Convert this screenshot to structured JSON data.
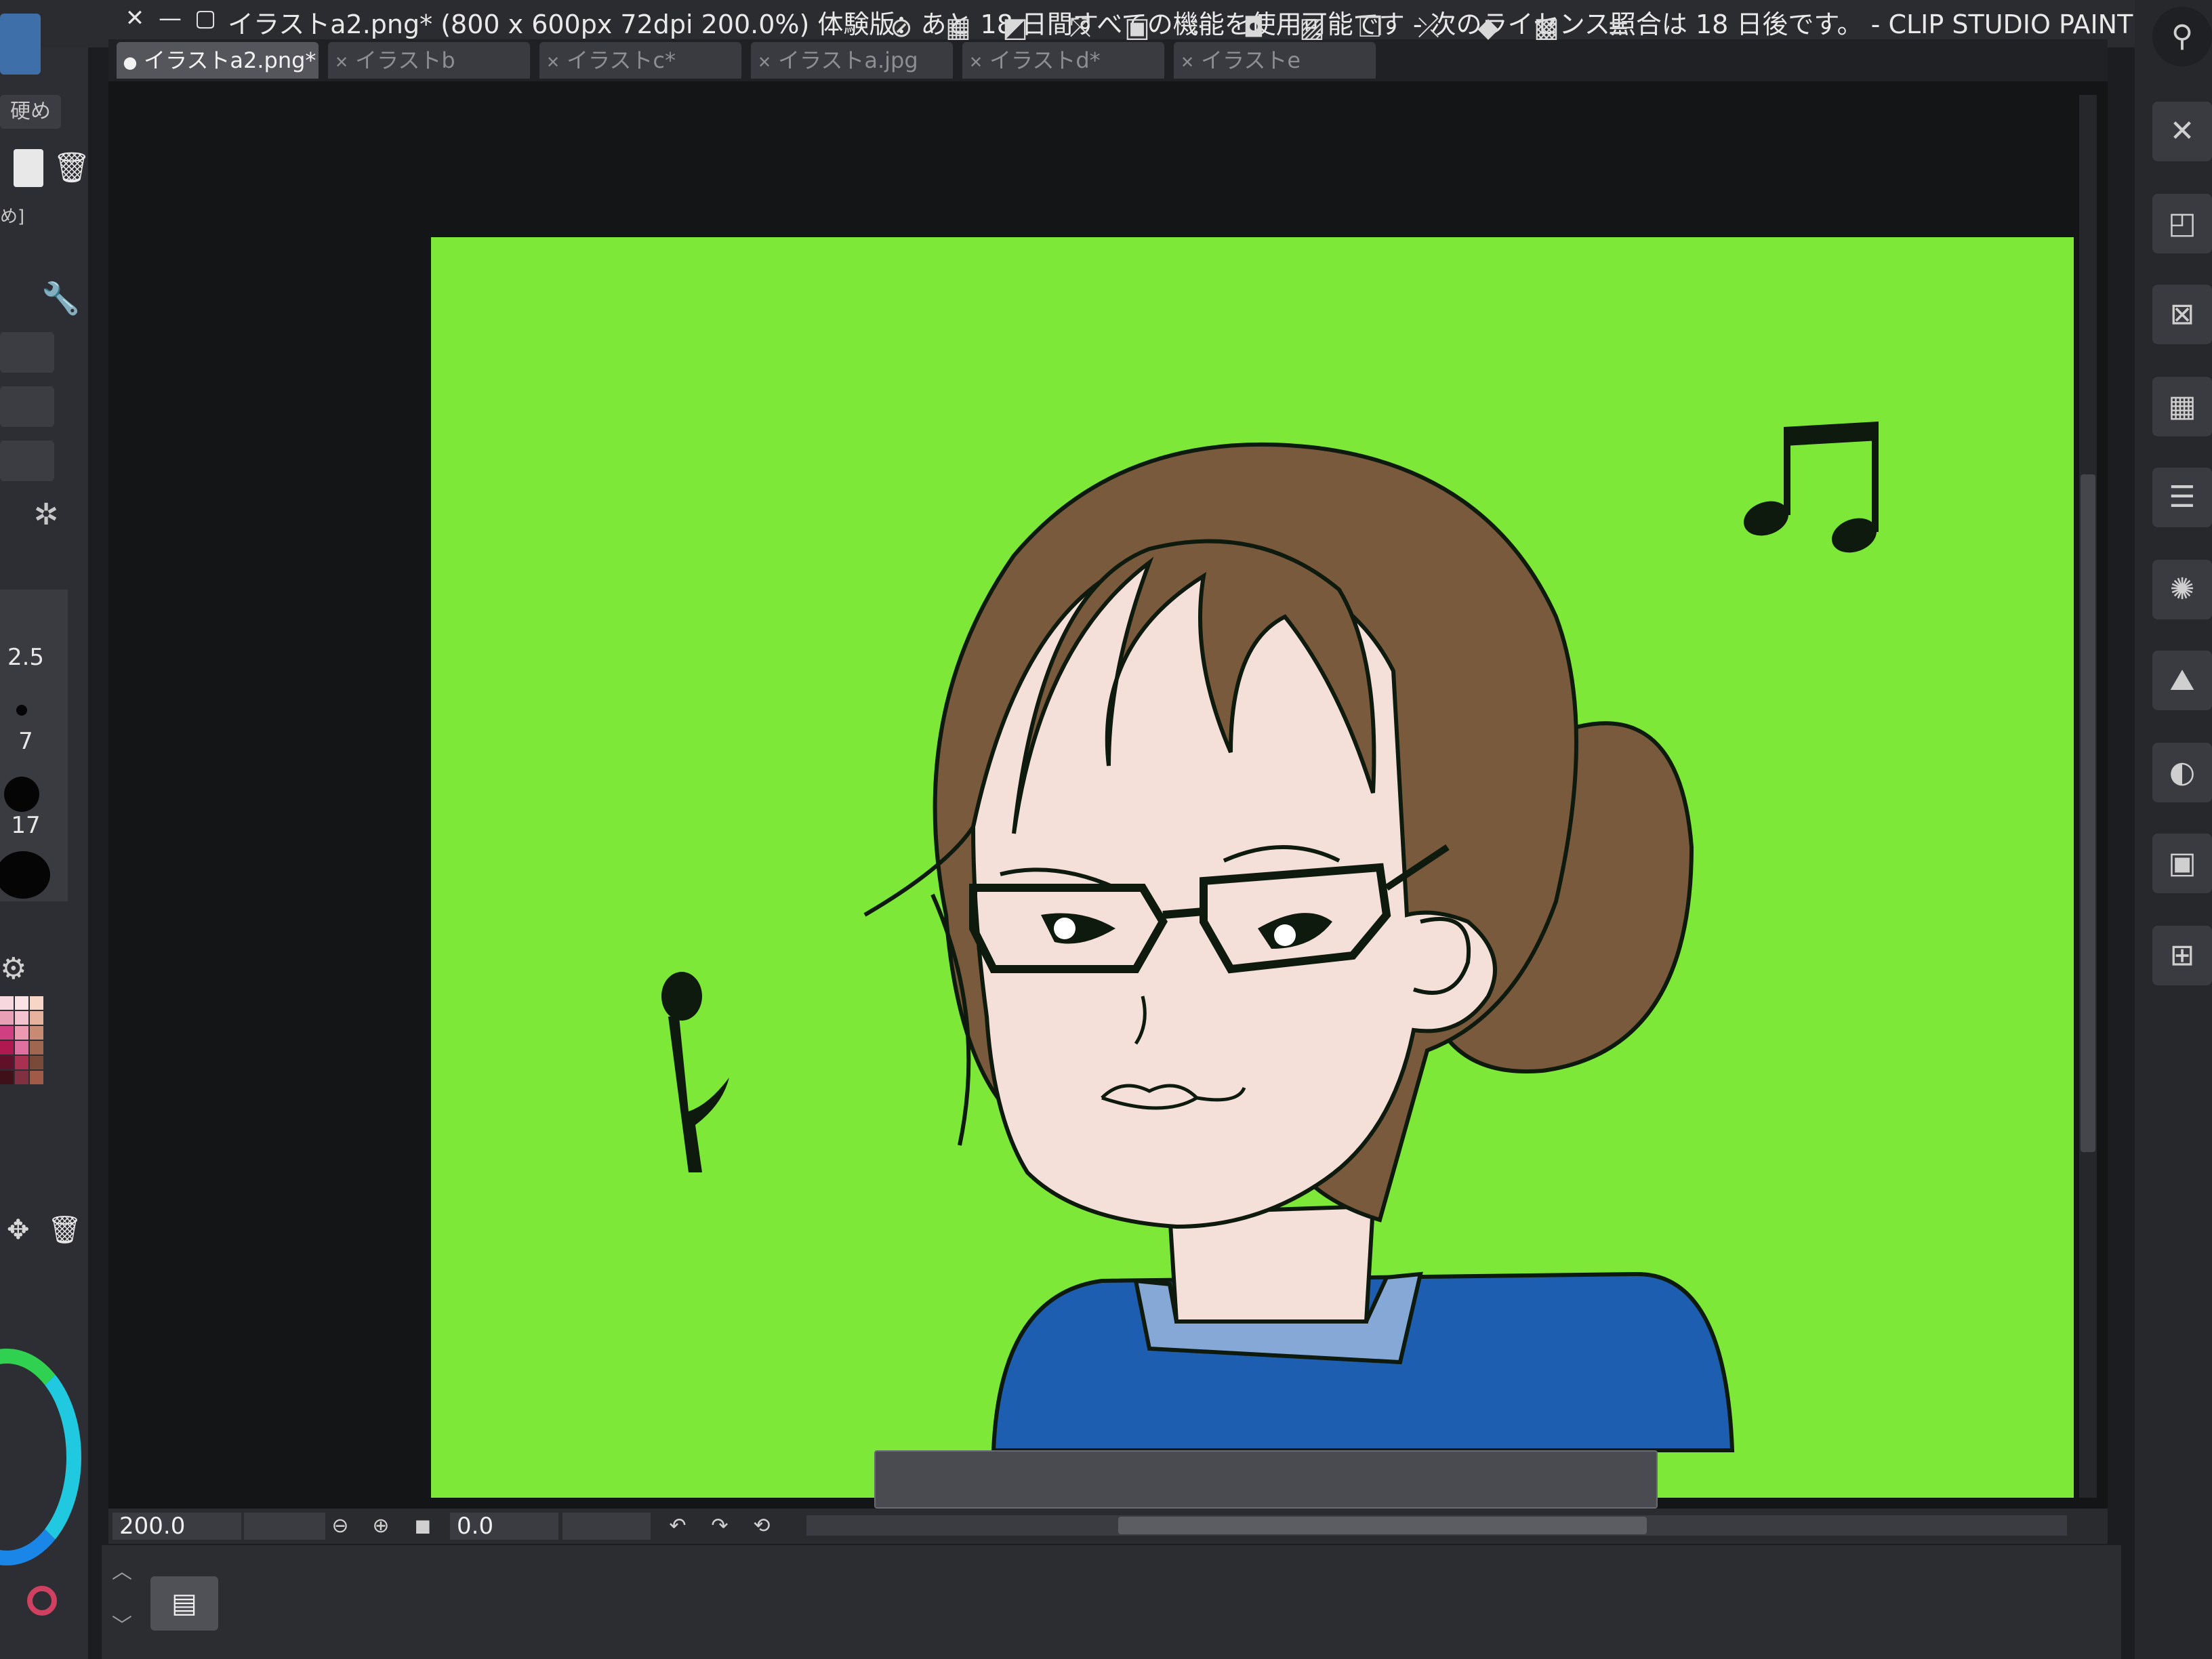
{
  "window": {
    "title": "イラストa2.png* (800 x 600px 72dpi 200.0%)  体験版：あと 18 日間すべての機能を使用可能です - 次のライセンス照合は 18 日後です。 - CLIP STUDIO PAINT PRO",
    "close_glyph": "✕",
    "minimize_glyph": "—",
    "restore_glyph": "▢"
  },
  "tabs": [
    {
      "label": "イラストa2.png*",
      "active": true
    },
    {
      "label": "イラストb",
      "active": false
    },
    {
      "label": "イラストc*",
      "active": false
    },
    {
      "label": "イラストa.jpg",
      "active": false
    },
    {
      "label": "イラストd*",
      "active": false
    },
    {
      "label": "イラストe",
      "active": false
    }
  ],
  "left_panel": {
    "brush_hardness_label": "硬め",
    "sub_label": "め]",
    "brush_sizes": [
      "2.5",
      "7",
      "17"
    ]
  },
  "status": {
    "zoom": "200.0",
    "rotation": "0.0"
  },
  "command_bar": {
    "icons": [
      "deselect-icon",
      "select-all-icon",
      "invert-selection-icon",
      "crop-icon",
      "expand-selection-icon",
      "shrink-selection-icon",
      "border-selection-icon",
      "fill-selection-icon",
      "copy-paste-icon",
      "transform-icon",
      "scale-icon",
      "clear-icon",
      "new-layer-mask-icon",
      "settings-icon"
    ]
  },
  "timeline": {
    "button_glyph": "▤"
  },
  "colors": {
    "canvas_green": "#7ee838",
    "hair_brown": "#7a5a3c",
    "skin": "#f4e0d8",
    "shirt_blue": "#1e5eb0",
    "collar_blue": "#86a8d6"
  }
}
